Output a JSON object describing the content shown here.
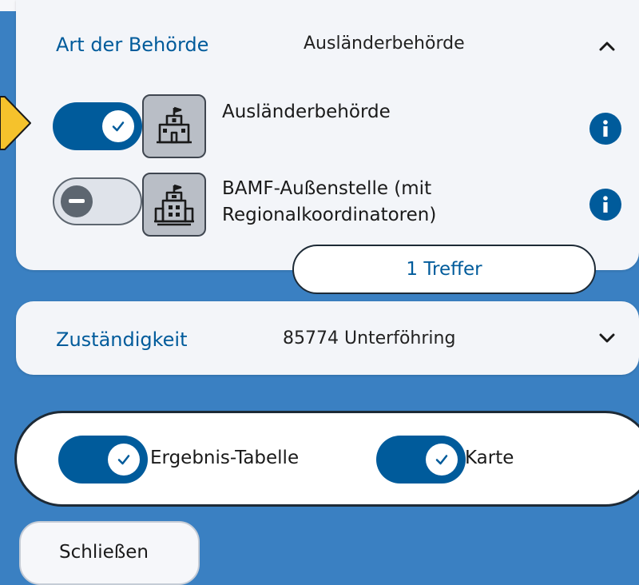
{
  "art_der_behoerde": {
    "label": "Art der Behörde",
    "value": "Ausländerbehörde",
    "options": [
      {
        "label": "Ausländerbehörde",
        "checked": true,
        "icon": "building-icon"
      },
      {
        "label_line1": "BAMF-Außenstelle (mit",
        "label_line2": "Regionalkoordinatoren)",
        "checked": false,
        "icon": "government-building-icon"
      }
    ],
    "treffer": "1 Treffer"
  },
  "zustaendigkeit": {
    "label": "Zuständigkeit",
    "value": "85774 Unterföhring"
  },
  "views": {
    "ergebnis_tabelle": "Ergebnis-Tabelle",
    "karte": "Karte"
  },
  "close_label": "Schließen",
  "colors": {
    "primary": "#005b9b",
    "background": "#3a80c2",
    "panel": "#f3f5f9",
    "highlight": "#f5c22c"
  }
}
